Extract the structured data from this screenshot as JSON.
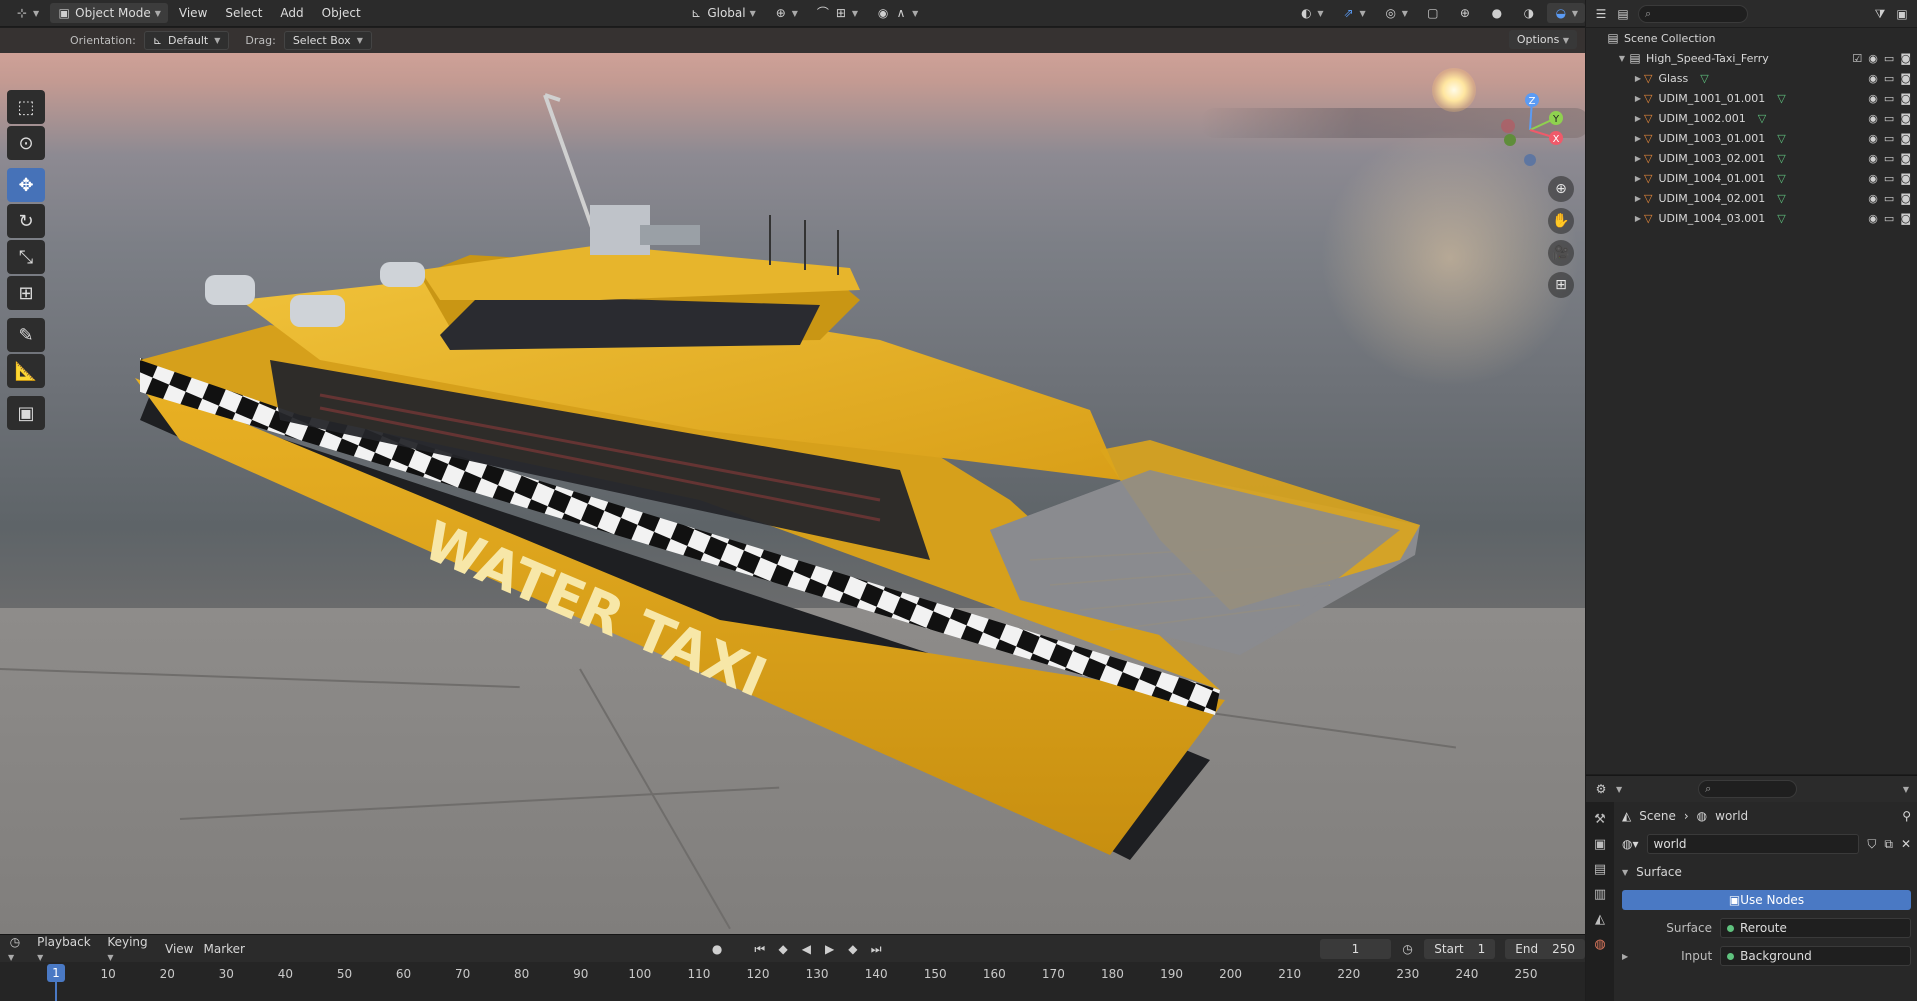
{
  "header": {
    "mode": "Object Mode",
    "menus": [
      "View",
      "Select",
      "Add",
      "Object"
    ],
    "transform_orientation": "Global"
  },
  "tool_header": {
    "orientation_label": "Orientation:",
    "orientation_value": "Default",
    "drag_label": "Drag:",
    "drag_value": "Select Box",
    "options_label": "Options"
  },
  "viewport": {
    "boat_text": "WATER TAXI",
    "gizmo_axes": [
      "Z",
      "Y",
      "X"
    ]
  },
  "outliner": {
    "root": "Scene Collection",
    "collection": "High_Speed-Taxi_Ferry",
    "items": [
      {
        "name": "Glass"
      },
      {
        "name": "UDIM_1001_01.001"
      },
      {
        "name": "UDIM_1002.001"
      },
      {
        "name": "UDIM_1003_01.001"
      },
      {
        "name": "UDIM_1003_02.001"
      },
      {
        "name": "UDIM_1004_01.001"
      },
      {
        "name": "UDIM_1004_02.001"
      },
      {
        "name": "UDIM_1004_03.001"
      }
    ]
  },
  "properties": {
    "breadcrumb_scene": "Scene",
    "breadcrumb_world": "world",
    "world_field": "world",
    "section_surface": "Surface",
    "use_nodes": "Use Nodes",
    "surface_label": "Surface",
    "surface_value": "Reroute",
    "input_label": "Input",
    "input_value": "Background"
  },
  "timeline": {
    "menus": [
      "Playback",
      "Keying",
      "View",
      "Marker"
    ],
    "current_frame": "1",
    "start_label": "Start",
    "start_value": "1",
    "end_label": "End",
    "end_value": "250",
    "ticks": [
      "10",
      "20",
      "30",
      "40",
      "50",
      "60",
      "70",
      "80",
      "90",
      "100",
      "110",
      "120",
      "130",
      "140",
      "150",
      "160",
      "170",
      "180",
      "190",
      "200",
      "210",
      "220",
      "230",
      "240",
      "250"
    ]
  },
  "colors": {
    "accent": "#4a79c4",
    "boat_yellow": "#e3a81b",
    "object_icon": "#e8893a",
    "mesh_icon": "#5fc27e"
  }
}
